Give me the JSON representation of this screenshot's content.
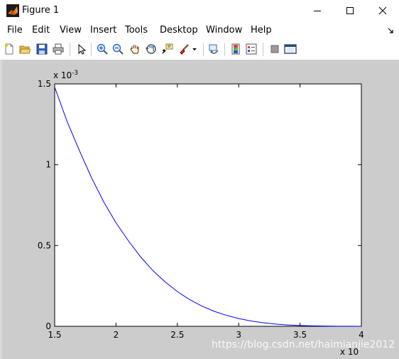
{
  "window": {
    "title": "Figure 1",
    "icon": "matlab-icon",
    "controls": [
      "minimize-icon",
      "maximize-icon",
      "close-icon"
    ]
  },
  "menu": {
    "items": [
      "File",
      "Edit",
      "View",
      "Insert",
      "Tools",
      "Desktop",
      "Window",
      "Help"
    ],
    "dock_icon": "dock-arrow-icon"
  },
  "toolbar": {
    "buttons": [
      "new-figure-icon",
      "open-file-icon",
      "save-icon",
      "print-icon",
      "edit-plot-arrow-icon",
      "zoom-in-icon",
      "zoom-out-icon",
      "pan-hand-icon",
      "rotate-3d-icon",
      "data-cursor-icon",
      "brush-icon",
      "brush-dropdown-icon",
      "link-plot-icon",
      "colorbar-icon",
      "legend-icon",
      "hide-plot-tools-icon",
      "show-plot-tools-icon"
    ]
  },
  "watermark": "https://blog.csdn.net/haimianjie2012",
  "chart_data": {
    "type": "line",
    "xlim": [
      1.5,
      4
    ],
    "ylim": [
      0,
      1.5
    ],
    "x_ticks": [
      "1.5",
      "2",
      "2.5",
      "3",
      "3.5",
      "4"
    ],
    "y_ticks": [
      "0",
      "0.5",
      "1",
      "1.5"
    ],
    "x_exponent": "x 10",
    "y_exponent": "x 10",
    "y_exponent_power": "-3",
    "grid": false,
    "series": [
      {
        "color": "#0000ff",
        "x": [
          1.5,
          1.6,
          1.7,
          1.8,
          1.9,
          2.0,
          2.1,
          2.2,
          2.3,
          2.4,
          2.5,
          2.6,
          2.7,
          2.8,
          2.9,
          3.0,
          3.1,
          3.2,
          3.3,
          3.4,
          3.5,
          3.6,
          3.7,
          3.8,
          3.9,
          4.0
        ],
        "y": [
          1.48,
          1.27,
          1.09,
          0.92,
          0.77,
          0.64,
          0.53,
          0.43,
          0.345,
          0.275,
          0.215,
          0.165,
          0.125,
          0.093,
          0.068,
          0.048,
          0.033,
          0.022,
          0.014,
          0.008,
          0.005,
          0.003,
          0.0015,
          0.0008,
          0.0003,
          0.0001
        ]
      }
    ]
  }
}
